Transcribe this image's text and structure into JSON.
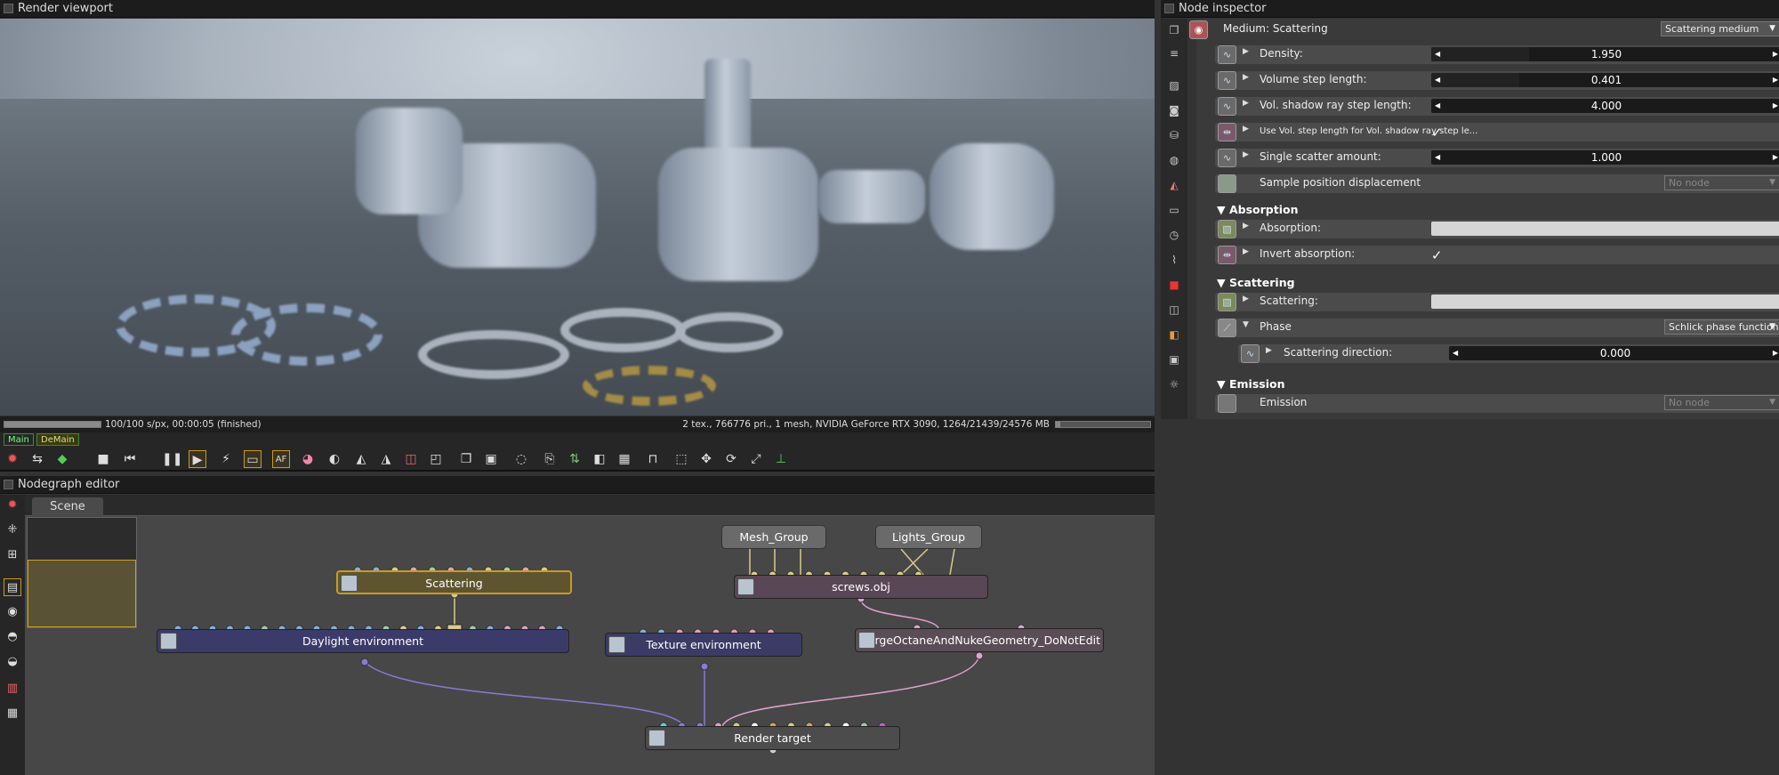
{
  "viewport": {
    "title": "Render viewport",
    "status_left": "100/100 s/px, 00:00:05 (finished)",
    "status_right": "2 tex., 766776 pri., 1 mesh, NVIDIA GeForce RTX 3090, 1264/21439/24576 MB",
    "progress": 1.0,
    "gpu_usage": 0.051,
    "tabs": [
      "Main",
      "DeMain"
    ]
  },
  "inspector": {
    "title": "Node inspector",
    "node_label": "Medium: Scattering",
    "node_type": "Scattering medium",
    "params": [
      {
        "label": "Density:",
        "value": "1.950",
        "kind": "slider",
        "fill": 0.28
      },
      {
        "label": "Volume step length:",
        "value": "0.401",
        "kind": "slider",
        "fill": 0.25
      },
      {
        "label": "Vol. shadow ray step length:",
        "value": "4.000",
        "kind": "slider",
        "fill": 0.0
      },
      {
        "label": "Use Vol. step length for Vol. shadow ray step le...",
        "value": "✓",
        "kind": "check"
      },
      {
        "label": "Single scatter amount:",
        "value": "1.000",
        "kind": "slider",
        "fill": 0.0
      },
      {
        "label": "Sample position displacement",
        "value": "No node",
        "kind": "dropdown"
      }
    ],
    "absorption_section": "Absorption",
    "absorption": {
      "label": "Absorption:"
    },
    "invert_absorption": {
      "label": "Invert absorption:",
      "value": "✓"
    },
    "scattering_section": "Scattering",
    "scattering": {
      "label": "Scattering:"
    },
    "phase": {
      "label": "Phase",
      "value": "Schlick phase function"
    },
    "scattering_direction": {
      "label": "Scattering direction:",
      "value": "0.000"
    },
    "emission_section": "Emission",
    "emission": {
      "label": "Emission",
      "value": "No node"
    }
  },
  "nodegraph": {
    "title": "Nodegraph editor",
    "tab": "Scene",
    "nodes": {
      "scattering": "Scattering",
      "daylight": "Daylight environment",
      "texture_env": "Texture environment",
      "screws": "screws.obj",
      "merge": "MergeOctaneAndNukeGeometry_DoNotEdit",
      "render_target": "Render target",
      "mesh_group": "Mesh_Group",
      "lights_group": "Lights_Group"
    }
  },
  "colors": {
    "accent": "#c99a25",
    "daylight_node": "#3b3b6a",
    "texture_node": "#3b3b66",
    "screws_node": "#5a4756",
    "merge_node": "#5a4d55",
    "render_node": "#4c4c4c",
    "scattering_node": "#5e5530"
  }
}
